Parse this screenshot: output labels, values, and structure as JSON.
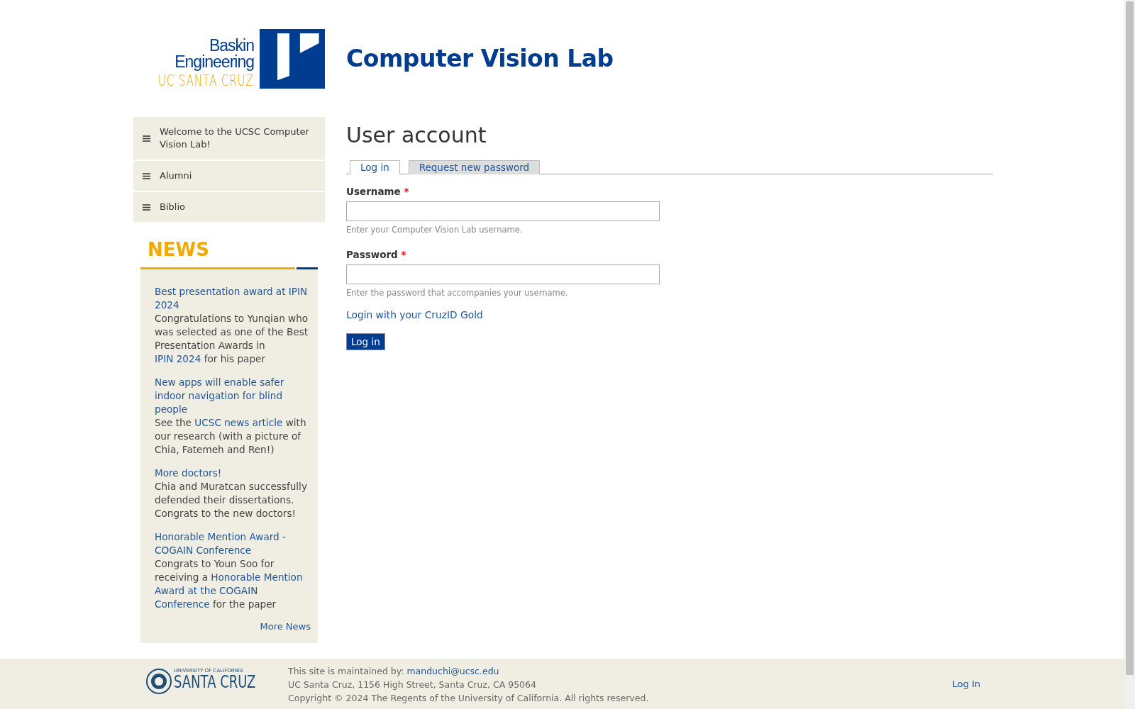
{
  "logo": {
    "lines": [
      "Baskin",
      "Engineering",
      "UC SANTA CRUZ"
    ]
  },
  "site_title": "Computer Vision Lab",
  "sidebar": {
    "items": [
      {
        "label": "Welcome to the UCSC Computer Vision Lab!"
      },
      {
        "label": "Alumni"
      },
      {
        "label": "Biblio"
      }
    ]
  },
  "news": {
    "heading": "NEWS",
    "items": [
      {
        "title": "Best presentation award at IPIN 2024",
        "body": [
          {
            "kind": "text",
            "text": "Congratulations to Yunqian who was selected as one of the Best Presentation Awards in "
          },
          {
            "kind": "link",
            "text": "IPIN 2024"
          },
          {
            "kind": "text",
            "text": " for his paper"
          }
        ]
      },
      {
        "title": "New apps will enable safer indoor navigation for blind people",
        "body": [
          {
            "kind": "text",
            "text": "See the "
          },
          {
            "kind": "link",
            "text": "UCSC news article"
          },
          {
            "kind": "text",
            "text": " with our research (with a picture of Chia, Fatemeh and Ren!)"
          }
        ]
      },
      {
        "title": "More doctors!",
        "body": [
          {
            "kind": "text",
            "text": "Chia and Muratcan successfully defended their dissertations. Congrats to the new doctors!"
          }
        ]
      },
      {
        "title": "Honorable Mention Award - COGAIN Conference",
        "body": [
          {
            "kind": "text",
            "text": "Congrats to Youn Soo for receiving a "
          },
          {
            "kind": "link",
            "text": "Honorable Mention"
          },
          {
            "kind": "link",
            "text": "Award at the COGAIN"
          },
          {
            "kind": "link",
            "text": "Conference"
          },
          {
            "kind": "text",
            "text": " for the paper"
          }
        ]
      }
    ],
    "more": "More News"
  },
  "page_title": "User account",
  "tabs": [
    {
      "label": "Log in",
      "selected": true
    },
    {
      "label": "Request new password",
      "selected": false
    }
  ],
  "fields": [
    {
      "label": "Username",
      "required": "*",
      "description": "Enter your Computer Vision Lab username."
    },
    {
      "label": "Password",
      "required": "*",
      "description": "Enter the password that accompanies your username."
    }
  ],
  "cruzid_link": "Login with your CruzID Gold",
  "submit": "Log in",
  "footer": {
    "logo": [
      "UNIVERSITY OF CALIFORNIA",
      "SANTA CRUZ"
    ],
    "maintained_by": "This site is maintained by: ",
    "email": "manduchi@ucsc.edu",
    "address": "UC Santa Cruz, 1156 High Street, Santa Cruz, CA 95064",
    "copyright": "Copyright © 2024 The Regents of the University of California. All rights reserved.",
    "login": "Log In"
  }
}
